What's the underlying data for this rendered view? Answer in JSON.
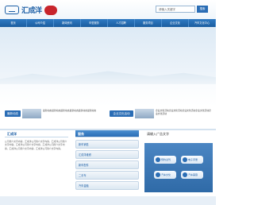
{
  "header": {
    "logo_text": "汇成洋",
    "search_placeholder": "请输入关键字",
    "search_button": "搜索"
  },
  "nav": {
    "items": [
      "首页",
      "公司介绍",
      "新闻资讯",
      "车型服务",
      "人才招聘",
      "服务项目",
      "企业文化",
      "汽车文化中心"
    ]
  },
  "news": {
    "tag": "最新动态",
    "item_text": "最新动态最新动态最新动态最新动态最新动态最新动态"
  },
  "culture": {
    "tag": "企业文化活动",
    "item_text": "企业文化活动企业文化活动企业文化活动企业文化活动企业文化活动"
  },
  "about": {
    "title": "汇成洋",
    "body": "公司简介文字内容，汇成洋公司简介文字内容，汇成洋公司简介文字内容。汇成洋公司简介文字内容，汇成洋公司简介文字内容，汇成洋公司简介文字内容，汇成洋公司简介文字内容。"
  },
  "services": {
    "title": "服务",
    "items": [
      "新车销售",
      "汇成洋维修",
      "新车配件",
      "二手车",
      "汽车金融"
    ]
  },
  "ad": {
    "title": "请输入广告文字",
    "buttons": [
      "预约试驾",
      "电子手册",
      "汽车文化",
      "汽车美容"
    ]
  }
}
